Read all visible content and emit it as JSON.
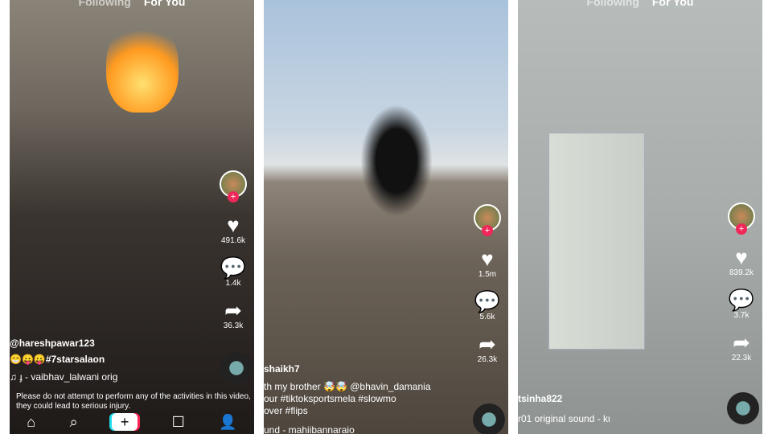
{
  "panels": [
    {
      "header": {
        "following": "Following",
        "for_you": "For You"
      },
      "likes": "491.6k",
      "comments": "1.4k",
      "shares": "36.3k",
      "username": "@hareshpawar123",
      "caption": "😁😛😛#7starsalaon",
      "sound": "♫ ɟ - vaibhav_lalwani    orig",
      "warning": "Please do not attempt to perform any of the activities in this video, they could lead to serious injury.",
      "nav": {
        "home": "⌂",
        "discover": "⌕",
        "create": "+",
        "inbox": "☐",
        "me": "👤"
      }
    },
    {
      "likes": "1.5m",
      "comments": "5.6k",
      "shares": "26.3k",
      "username": "shaikh7",
      "caption_lines": [
        "th my brother 🤯🤯 @bhavin_damania",
        "our #tiktoksportsmela #slowmo",
        "over #flips"
      ],
      "sound": "und - mahiibannaraio"
    },
    {
      "header": {
        "following": "Following",
        "for_you": "For You"
      },
      "likes": "839.2k",
      "comments": "3.7k",
      "shares": "22.3k",
      "username": "tsinha822",
      "sound": "r01   original sound - kι"
    }
  ],
  "colors": {
    "accent": "#f0285a"
  }
}
